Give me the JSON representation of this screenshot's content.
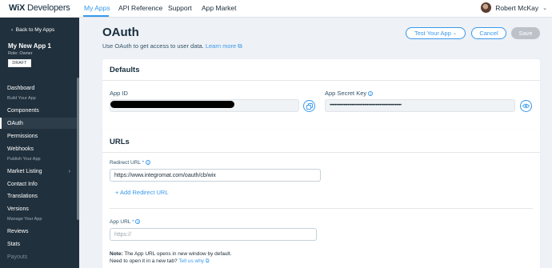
{
  "topbar": {
    "brand_wix": "WiX",
    "brand_dev": "Developers",
    "nav": [
      "My Apps",
      "API Reference",
      "Support",
      "App Market"
    ],
    "user_name": "Robert McKay"
  },
  "sidebar": {
    "back_label": "Back to My Apps",
    "app_name": "My New App 1",
    "app_role": "Role: Owner",
    "status": "DRAFT",
    "items": {
      "dashboard": "Dashboard",
      "build_section": "Build Your App",
      "components": "Components",
      "oauth": "OAuth",
      "permissions": "Permissions",
      "webhooks": "Webhooks",
      "publish_section": "Publish Your App",
      "market_listing": "Market Listing",
      "contact_info": "Contact Info",
      "translations": "Translations",
      "versions": "Versions",
      "manage_section": "Manage Your App",
      "reviews": "Reviews",
      "stats": "Stats",
      "payouts": "Payouts"
    }
  },
  "header": {
    "title": "OAuth",
    "subtitle": "Use OAuth to get access to user data.",
    "learn_more": "Learn more",
    "test_button": "Test Your App",
    "cancel_button": "Cancel",
    "save_button": "Save"
  },
  "defaults": {
    "title": "Defaults",
    "app_id_label": "App ID",
    "app_secret_label": "App Secret Key",
    "app_secret_value": "••••••••••••••••••••••••••••••••••••••••••••••••••••••••"
  },
  "urls": {
    "title": "URLs",
    "redirect_label": "Redirect URL",
    "redirect_required": "*",
    "redirect_value": "https://www.integromat.com/oauth/cb/wix",
    "add_redirect": "+ Add Redirect URL",
    "app_url_label": "App URL",
    "app_url_required": "*",
    "app_url_placeholder": "https://",
    "note_label": "Note:",
    "note_line1": "The App URL opens in new window by default.",
    "note_line2": "Need to open it in a new tab?",
    "tell_us_why": "Tell us why"
  },
  "colors": {
    "accent": "#3899ec",
    "sidebar_bg": "#20303c",
    "page_bg": "#eef1f5"
  }
}
